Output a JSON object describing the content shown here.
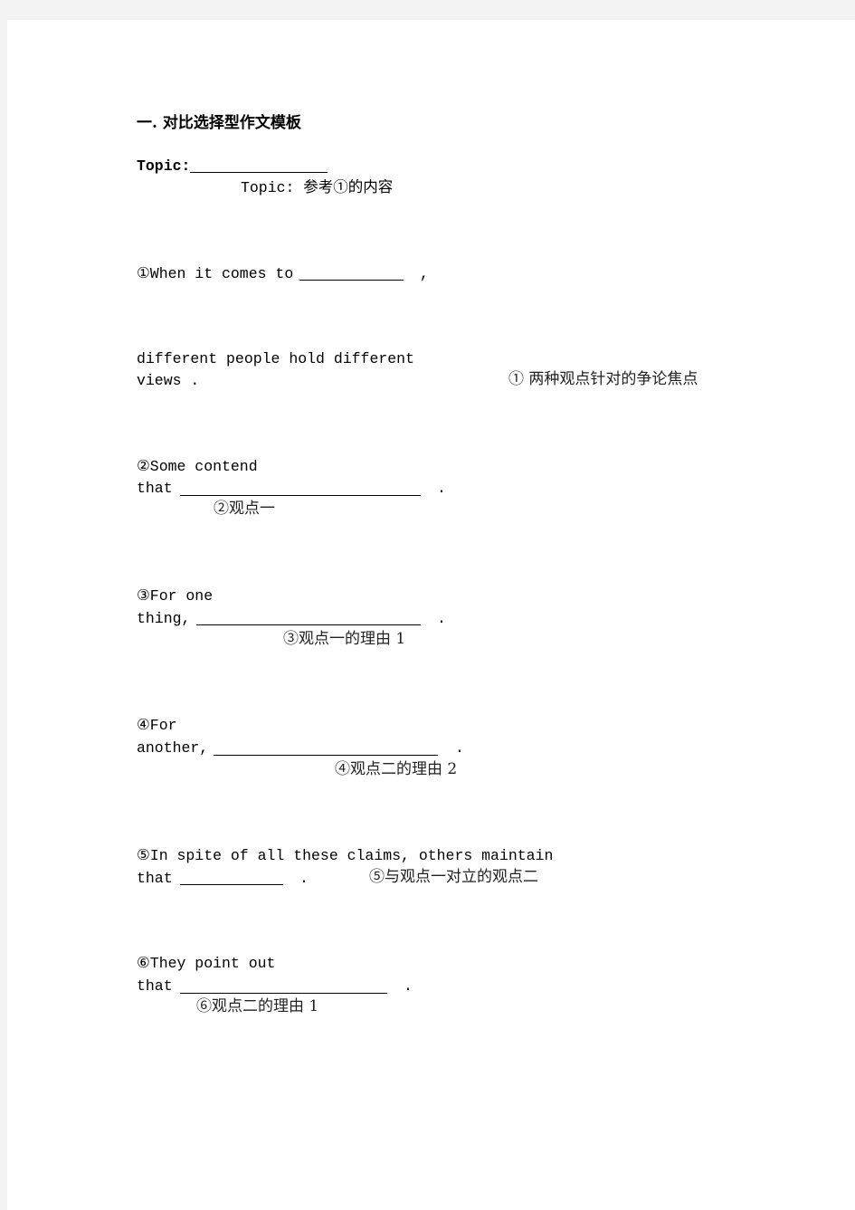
{
  "document": {
    "heading": "一. 对比选择型作文模板",
    "topic": {
      "label": "Topic:",
      "hint": "Topic: 参考①的内容"
    },
    "sections": [
      {
        "lines": [
          "①When it comes to",
          ","
        ],
        "hint": "① 两种观点针对的争论焦点"
      },
      {
        "lines": [
          "different people hold different",
          "views ."
        ]
      },
      {
        "lines": [
          "②Some contend",
          "that",
          "."
        ],
        "hint": "②观点一"
      },
      {
        "lines": [
          "③For one",
          "thing,",
          "."
        ],
        "hint": "③观点一的理由 1"
      },
      {
        "lines": [
          "④For",
          "another,",
          "."
        ],
        "hint": "④观点二的理由 2"
      },
      {
        "lines": [
          "⑤In spite of all these claims, others maintain",
          "that",
          "."
        ],
        "hint": "⑤与观点一对立的观点二"
      },
      {
        "lines": [
          "⑥They point out",
          "that",
          "."
        ],
        "hint": "⑥观点二的理由 1"
      }
    ]
  }
}
